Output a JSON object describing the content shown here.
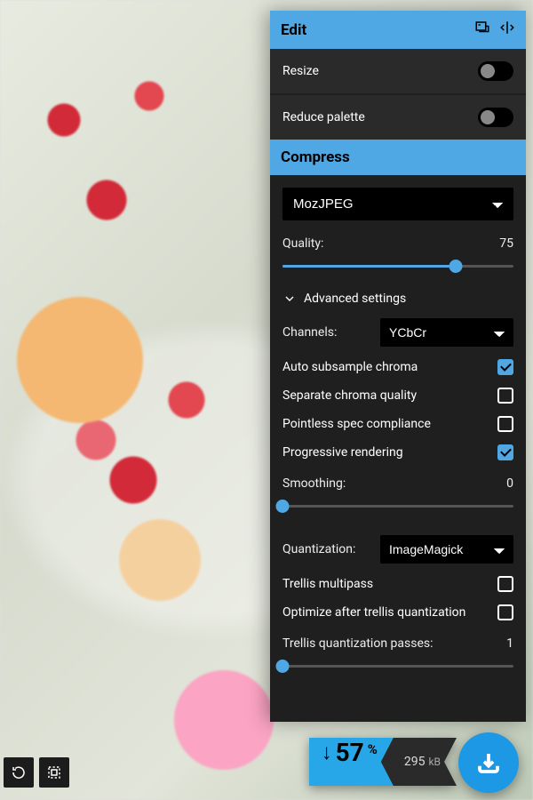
{
  "header": {
    "title": "Edit"
  },
  "edit": {
    "resize": {
      "label": "Resize",
      "on": false
    },
    "reduce_palette": {
      "label": "Reduce palette",
      "on": false
    }
  },
  "compress": {
    "title": "Compress",
    "encoder": "MozJPEG",
    "quality": {
      "label": "Quality:",
      "value": 75,
      "min": 0,
      "max": 100
    },
    "advanced_label": "Advanced settings",
    "channels": {
      "label": "Channels:",
      "value": "YCbCr"
    },
    "auto_subsample": {
      "label": "Auto subsample chroma",
      "on": true
    },
    "separate_chroma": {
      "label": "Separate chroma quality",
      "on": false
    },
    "pointless_spec": {
      "label": "Pointless spec compliance",
      "on": false
    },
    "progressive": {
      "label": "Progressive rendering",
      "on": true
    },
    "smoothing": {
      "label": "Smoothing:",
      "value": 0,
      "min": 0,
      "max": 100
    },
    "quantization": {
      "label": "Quantization:",
      "value": "ImageMagick"
    },
    "trellis_multipass": {
      "label": "Trellis multipass",
      "on": false
    },
    "optimize_after_trellis": {
      "label": "Optimize after trellis quantization",
      "on": false
    },
    "trellis_passes": {
      "label": "Trellis quantization passes:",
      "value": 1,
      "min": 1,
      "max": 50
    }
  },
  "result": {
    "reduction_percent": 57,
    "percent_symbol": "%",
    "size_value": 295,
    "size_unit": "kB"
  }
}
